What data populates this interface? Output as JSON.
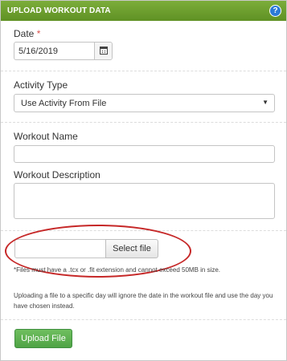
{
  "header": {
    "title": "UPLOAD WORKOUT DATA",
    "help_glyph": "?"
  },
  "date_field": {
    "label": "Date",
    "required_mark": "*",
    "value": "5/16/2019",
    "icon": "calendar-icon"
  },
  "activity_field": {
    "label": "Activity Type",
    "selected": "Use Activity From File",
    "caret": "▼"
  },
  "workout_name": {
    "label": "Workout Name",
    "value": ""
  },
  "workout_description": {
    "label": "Workout Description",
    "value": ""
  },
  "file_upload": {
    "value": "",
    "button_label": "Select file",
    "note_extension": "*Files must have a .tcx or .fit extension and cannot exceed 50MB in size.",
    "note_date": "Uploading a file to a specific day will ignore the date in the workout file and use the day you have chosen instead."
  },
  "actions": {
    "upload_label": "Upload File"
  },
  "colors": {
    "header_green": "#6a9c2a",
    "upload_button_green": "#4fa345",
    "annotation_red": "#c62828",
    "required_red": "#d9534f"
  }
}
